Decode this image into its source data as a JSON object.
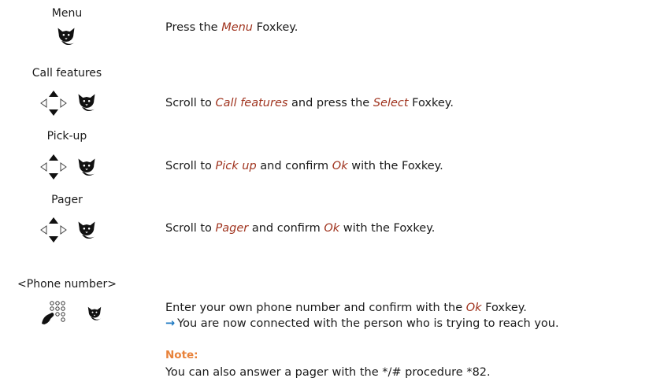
{
  "steps": [
    {
      "key_label": "Menu",
      "icons": [
        "foxkey-icon"
      ],
      "instruction": {
        "pre": "Press the ",
        "h1": "Menu",
        "mid": " Foxkey.",
        "h2": "",
        "post": ""
      }
    },
    {
      "key_label": "Call features",
      "icons": [
        "navigation-keys-icon",
        "foxkey-icon"
      ],
      "instruction": {
        "pre": "Scroll to ",
        "h1": "Call features",
        "mid": " and press the ",
        "h2": "Select",
        "post": " Foxkey."
      }
    },
    {
      "key_label": "Pick-up",
      "icons": [
        "navigation-keys-icon",
        "foxkey-icon"
      ],
      "instruction": {
        "pre": "Scroll to ",
        "h1": "Pick up",
        "mid": " and confirm ",
        "h2": "Ok",
        "post": " with the Foxkey."
      }
    },
    {
      "key_label": "Pager",
      "icons": [
        "navigation-keys-icon",
        "foxkey-icon"
      ],
      "instruction": {
        "pre": "Scroll to ",
        "h1": "Pager",
        "mid": " and confirm ",
        "h2": "Ok",
        "post": " with the Foxkey."
      }
    },
    {
      "key_label": "<Phone number>",
      "icons": [
        "keypad-dialing-icon",
        "foxkey-icon"
      ],
      "instruction": {
        "pre": "Enter your own phone number and confirm with the  ",
        "h1": "Ok",
        "mid": "  Foxkey.",
        "h2": "",
        "post": ""
      },
      "result": "You are now connected with the person who is trying to reach you."
    }
  ],
  "note": {
    "title": "Note:",
    "text": "You can also answer a pager with the */# procedure *82."
  },
  "colors": {
    "highlight": "#a0341f",
    "note_title": "#e8823a",
    "arrow": "#1f7ac2"
  }
}
